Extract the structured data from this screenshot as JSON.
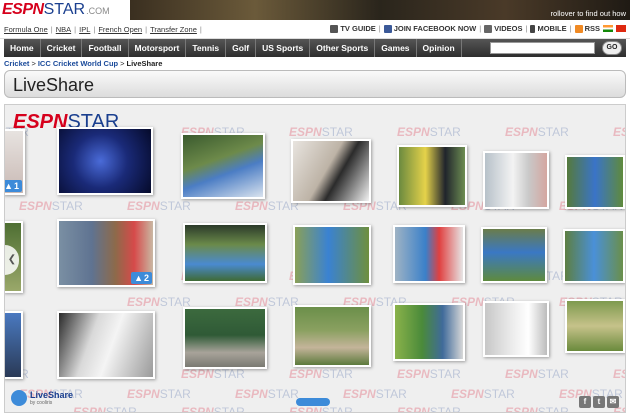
{
  "logo": {
    "espn": "ESPN",
    "star": "STAR",
    "dotcom": ".COM"
  },
  "promo": {
    "text": "rollover to find out how"
  },
  "subnav": {
    "left": [
      "Formula One",
      "NBA",
      "IPL",
      "French Open",
      "Transfer Zone"
    ],
    "right": [
      "TV GUIDE",
      "JOIN FACEBOOK NOW",
      "VIDEOS",
      "MOBILE",
      "RSS"
    ]
  },
  "mainnav": {
    "items": [
      "Home",
      "Cricket",
      "Football",
      "Motorsport",
      "Tennis",
      "Golf",
      "US Sports",
      "Other Sports",
      "Games",
      "Opinion"
    ],
    "search_placeholder": "",
    "go_label": "GO"
  },
  "breadcrumb": {
    "items": [
      "Cricket",
      "ICC Cricket World Cup"
    ],
    "current": "LiveShare"
  },
  "page": {
    "title": "LiveShare"
  },
  "widget": {
    "brand_espn": "ESPN",
    "brand_star": "STAR",
    "like_counts": [
      "1",
      "2"
    ],
    "footer_name": "LiveShare",
    "footer_by": "by cooliris",
    "share_icons": [
      "facebook-icon",
      "twitter-icon",
      "email-icon"
    ]
  },
  "colors": {
    "espn_red": "#d6001c",
    "star_blue": "#1a3f8f",
    "like_blue": "#3d8bd9",
    "nav_dark": "#2e2e2e"
  }
}
